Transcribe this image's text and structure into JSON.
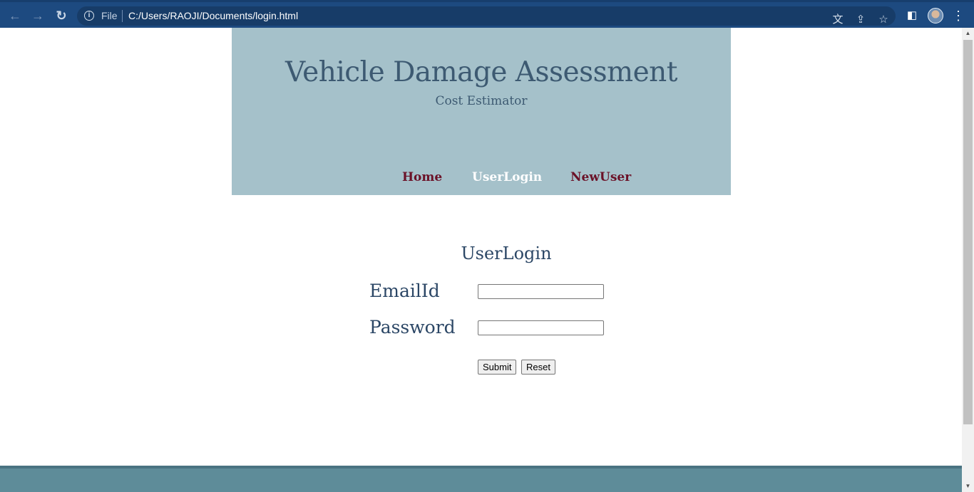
{
  "browser": {
    "back_icon": "←",
    "forward_icon": "→",
    "reload_icon": "↻",
    "info_icon": "i",
    "file_label": "File",
    "url": "C:/Users/RAOJI/Documents/login.html",
    "translate_icon": "文",
    "share_icon": "⇪",
    "bookmark_icon": "☆",
    "sidepanel_icon": "◧",
    "menu_icon": "⋮"
  },
  "header": {
    "title": "Vehicle Damage Assessment",
    "subtitle": "Cost Estimator"
  },
  "nav": {
    "home": "Home",
    "userlogin": "UserLogin",
    "newuser": "NewUser"
  },
  "login": {
    "title": "UserLogin",
    "email_label": "EmailId",
    "email_value": "",
    "password_label": "Password",
    "password_value": "",
    "submit_label": "Submit",
    "reset_label": "Reset"
  },
  "scrollbar": {
    "up_icon": "▲",
    "down_icon": "▼"
  },
  "colors": {
    "banner": "#a5c1ca",
    "title": "#3d5a72",
    "nav_link": "#6b1228",
    "nav_active": "#ffffff",
    "footer": "#5e8c99"
  }
}
